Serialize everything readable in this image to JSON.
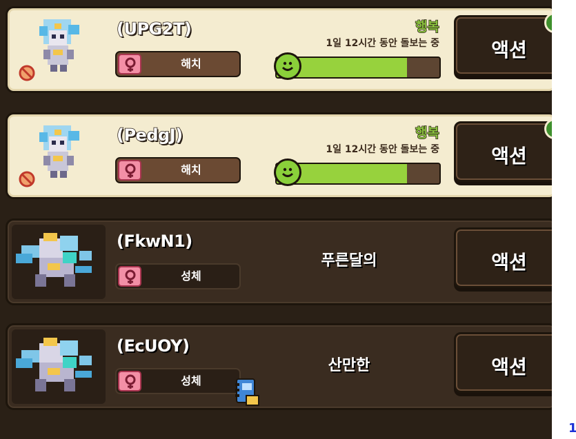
{
  "colors": {
    "panel_bg": "#2a2016",
    "card_light": "#f4ecd0",
    "card_dark": "#3a2c20",
    "mood_green": "#8ac33e",
    "bar_green": "#97d23d",
    "gender_pink": "#f38fa6"
  },
  "corner_mark": "1",
  "cards": [
    {
      "name": "(UPG2T)",
      "gender_icon": "female-icon",
      "stage": "해치",
      "mood": "행복",
      "care_status": "1일 12시간 동안 돌보는 중",
      "happiness": 0.8,
      "action": "액션"
    },
    {
      "name": "(PedgJ)",
      "gender_icon": "female-icon",
      "stage": "해치",
      "mood": "행복",
      "care_status": "1일 12시간 동안 돌보는 중",
      "happiness": 0.8,
      "action": "액션"
    },
    {
      "name": "(FkwN1)",
      "gender_icon": "female-icon",
      "stage": "성체",
      "trait": "푸른달의",
      "action": "액션"
    },
    {
      "name": "(EcUOY)",
      "gender_icon": "female-icon",
      "stage": "성체",
      "trait": "산만한",
      "action": "액션"
    }
  ]
}
